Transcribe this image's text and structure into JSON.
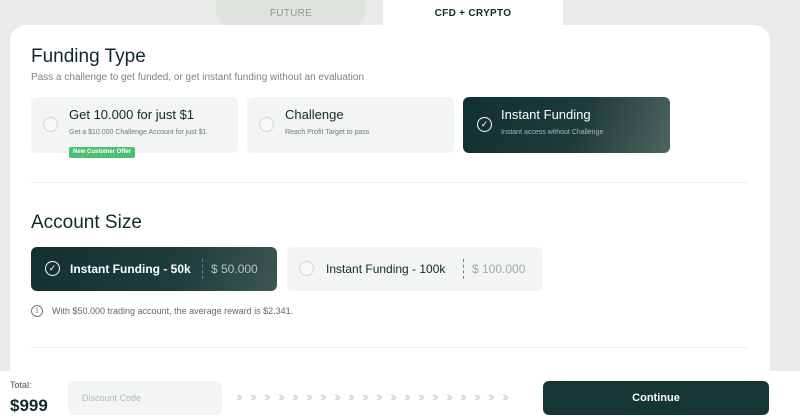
{
  "tabs": [
    {
      "label": "FUTURE"
    },
    {
      "label": "CFD + CRYPTO"
    }
  ],
  "funding": {
    "title": "Funding Type",
    "subtitle": "Pass a challenge to get funded, or get instant funding without an evaluation",
    "options": [
      {
        "title": "Get 10.000 for just $1",
        "desc": "Get a $10.000 Challenge Account for just $1",
        "badge": "New Customer Offer",
        "selected": false
      },
      {
        "title": "Challenge",
        "desc": "Reach Profit Target to pass",
        "selected": false
      },
      {
        "title": "Instant Funding",
        "desc": "Instant access without Challenge",
        "selected": true
      }
    ]
  },
  "account": {
    "title": "Account Size",
    "options": [
      {
        "title": "Instant Funding - 50k",
        "price": "$ 50.000",
        "selected": true
      },
      {
        "title": "Instant Funding - 100k",
        "price": "$ 100.000",
        "selected": false
      }
    ],
    "info": "With $50.000 trading account, the average reward is $2.341."
  },
  "bottom": {
    "total_label": "Total:",
    "total_value": "$999",
    "discount_placeholder": "Discount Code",
    "continue_label": "Continue"
  },
  "colors": {
    "primary_dark": "#163634",
    "badge_green": "#4cbf72",
    "background": "#e9ece8"
  },
  "icons": {
    "check": "check-icon",
    "info": "info-icon",
    "arrow": "chevron-right-icon"
  }
}
